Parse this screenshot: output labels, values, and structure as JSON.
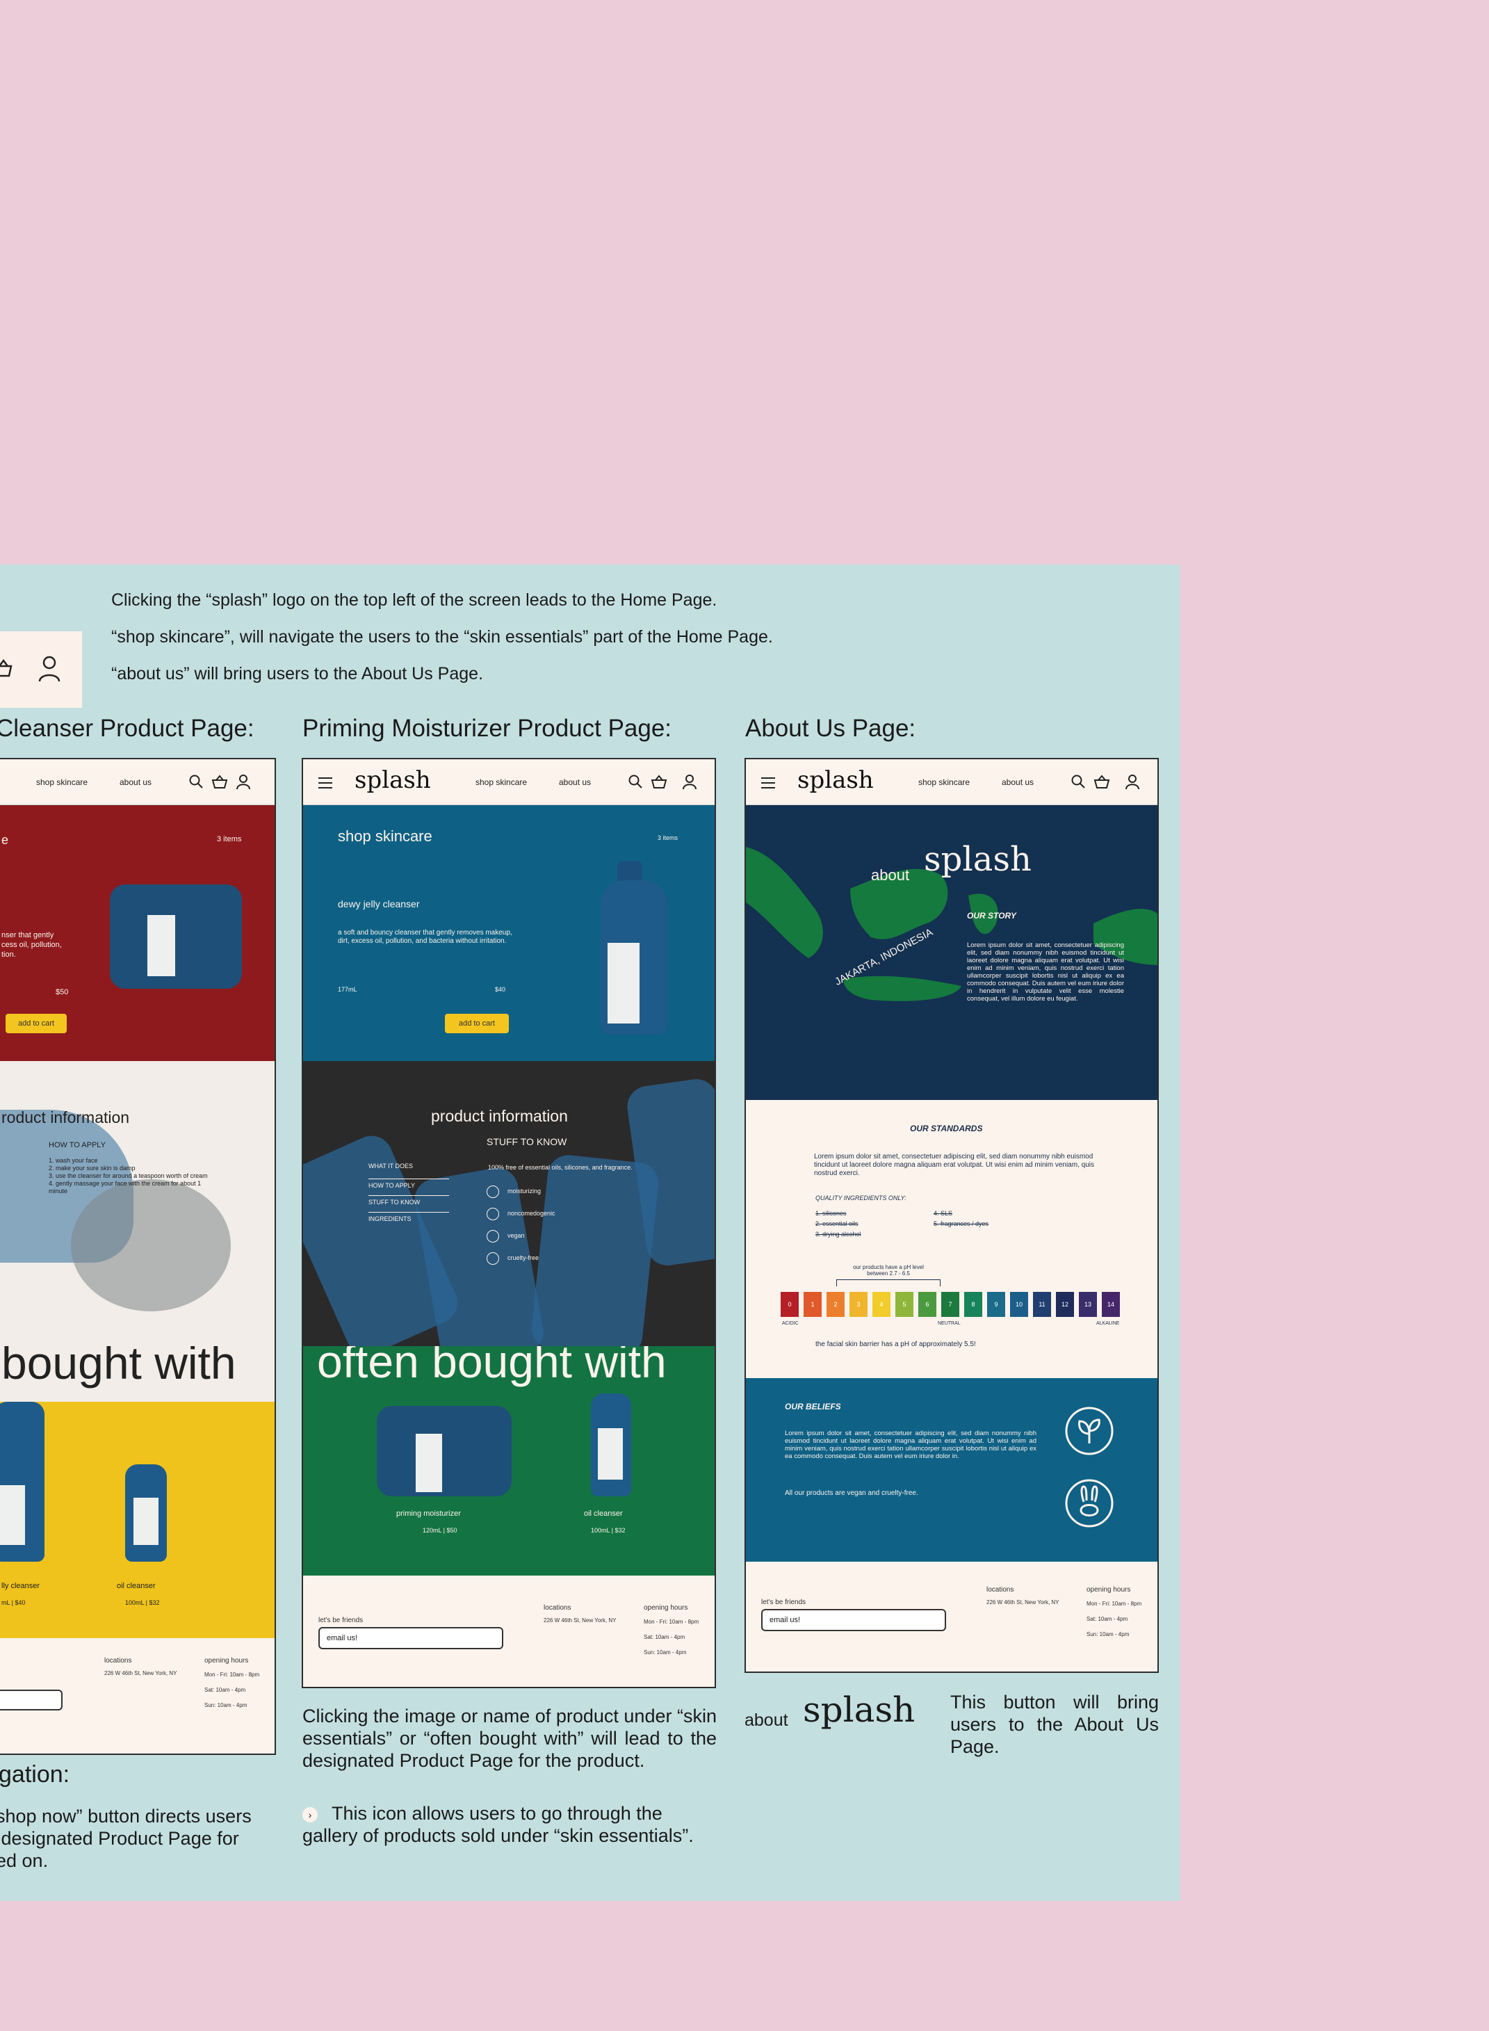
{
  "notes": [
    "Clicking the “splash” logo on the top left of the screen leads to the Home Page.",
    "“shop skincare”, will navigate the users to the “skin essentials” part of the Home Page.",
    "“about us” will bring users to the About Us Page."
  ],
  "columns": {
    "cleanser_title": "Cleanser Product Page:",
    "moisturizer_title": "Priming Moisturizer Product Page:",
    "about_title": "About Us Page:"
  },
  "nav": {
    "logo": "splash",
    "shop": "shop skincare",
    "about": "about us"
  },
  "cleanser": {
    "heading": "e",
    "items": "3 items",
    "desc": "nser that gently\ncess oil, pollution,\ntion.",
    "price": "$50",
    "add_to_cart": "add to cart",
    "product_info": "roduct information",
    "how_to_apply": "HOW TO APPLY",
    "steps": [
      "1. wash your face",
      "2. make your sure skin is damp",
      "3. use the cleanser for around a teaspoon worth of cream",
      "4. gently massage your face with the cream for about 1 minute"
    ],
    "often": "bought with",
    "p1_name": "lly cleanser",
    "p1_meta": "mL | $40",
    "p2_name": "oil cleanser",
    "p2_meta": "100mL | $32",
    "locations": "locations",
    "loc_addr": "226 W 46th St, New York, NY",
    "hours": "opening hours",
    "hours_lines": [
      "Mon - Fri: 10am - 8pm",
      "Sat: 10am - 4pm",
      "Sun: 10am - 4pm"
    ]
  },
  "moisturizer": {
    "shop": "shop skincare",
    "items": "3 items",
    "product": "dewy jelly cleanser",
    "desc": "a soft and bouncy cleanser that gently removes makeup, dirt, excess oil, pollution, and bacteria without irritation.",
    "size": "177mL",
    "price": "$40",
    "add_to_cart": "add to cart",
    "product_info": "product information",
    "stuff": "STUFF TO KNOW",
    "tabs": [
      "WHAT IT DOES",
      "HOW TO APPLY",
      "STUFF TO KNOW",
      "INGREDIENTS"
    ],
    "free_of": "100% free of essential oils, silicones, and fragrance.",
    "props": [
      "moisturizing",
      "noncomedogenic",
      "vegan",
      "cruelty-free"
    ],
    "often": "often bought with",
    "p1_name": "priming moisturizer",
    "p1_meta": "120mL | $50",
    "p2_name": "oil cleanser",
    "p2_meta": "100mL | $32",
    "friends": "let's be friends",
    "email": "email us!",
    "locations": "locations",
    "loc_addr": "226 W 46th St, New York, NY",
    "hours": "opening hours",
    "hours_lines": [
      "Mon - Fri: 10am - 8pm",
      "Sat: 10am - 4pm",
      "Sun: 10am - 4pm"
    ]
  },
  "about": {
    "about_word": "about",
    "logo": "splash",
    "map_label": "JAKARTA, INDONESIA",
    "our_story": "OUR STORY",
    "story_text": "Lorem ipsum dolor sit amet, consectetuer adipiscing elit, sed diam nonummy nibh euismod tincidunt ut laoreet dolore magna aliquam erat volutpat. Ut wisi enim ad minim veniam, quis nostrud exerci tation ullamcorper suscipit lobortis nisl ut aliquip ex ea commodo consequat. Duis autem vel eum iriure dolor in hendrerit in vulputate velit esse molestie consequat, vel illum dolore eu feugiat.",
    "our_standards": "OUR STANDARDS",
    "standards_text": "Lorem ipsum dolor sit amet, consectetuer adipiscing elit, sed diam nonummy nibh euismod tincidunt ut laoreet dolore magna aliquam erat volutpat. Ut wisi enim ad minim veniam, quis nostrud exerci.",
    "quality": "QUALITY INGREDIENTS ONLY:",
    "banned_left": [
      "1. silicones",
      "2. essential oils",
      "3. drying alcohol"
    ],
    "banned_right": [
      "4. SLS",
      "5. fragrances / dyes"
    ],
    "ph_note": "our products have a pH level between 2.7 - 6.5",
    "ph_acidic": "ACIDIC",
    "ph_neutral": "NEUTRAL",
    "ph_alkaline": "ALKALINE",
    "ph_scale": [
      "0",
      "1",
      "2",
      "3",
      "4",
      "5",
      "6",
      "7",
      "8",
      "9",
      "10",
      "11",
      "12",
      "13",
      "14"
    ],
    "ph_colors": [
      "#b42025",
      "#e0592a",
      "#ec7f2d",
      "#f0b52c",
      "#f2cc2b",
      "#8fb63a",
      "#4b9a3f",
      "#1d7a3f",
      "#17835a",
      "#1b6b8a",
      "#1b5e8a",
      "#203e70",
      "#1f2c5c",
      "#3a2d6b",
      "#45266b"
    ],
    "skin_ph": "the facial skin barrier has a pH of approximately 5.5!",
    "our_beliefs": "OUR BELIEFS",
    "beliefs_text": "Lorem ipsum dolor sit amet, consectetuer adipiscing elit, sed diam nonummy nibh euismod tincidunt ut laoreet dolore magna aliquam erat volutpat. Ut wisi enim ad minim veniam, quis nostrud exerci tation ullamcorper suscipit lobortis nisl ut aliquip ex ea commodo consequat. Duis autem vel eum iriure dolor in.",
    "vegan_line": "All our products are vegan and cruelty-free.",
    "friends": "let's be friends",
    "email": "email us!",
    "locations": "locations",
    "loc_addr": "226 W 46th St, New York, NY",
    "hours": "opening hours",
    "hours_lines": [
      "Mon - Fri: 10am - 8pm",
      "Sat: 10am - 4pm",
      "Sun: 10am - 4pm"
    ]
  },
  "captions": {
    "navigation": "gation:",
    "shop_now": "shop now” button directs users\n designated Product Page for\ned on.",
    "product_click": "Clicking the image or name of product under “skin essentials” or “often bought with” will lead to the designated Product Page for the product.",
    "gallery": "This icon allows users to go through the gallery of products sold under “skin essentials”.",
    "about_word": "about",
    "about_logo": "splash",
    "about_btn": "This button will bring users to the About Us Page."
  }
}
